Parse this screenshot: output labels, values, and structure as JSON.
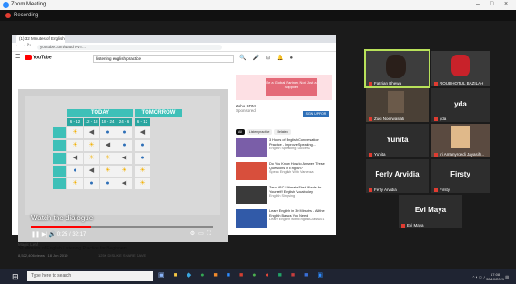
{
  "window": {
    "title": "Zoom Meeting",
    "controls": [
      "–",
      "□",
      "×"
    ]
  },
  "recording": {
    "label": "Recording"
  },
  "browser": {
    "tab_label": "(1) 32 Minutes of English ...",
    "url": "youtube.com/watch?v=..."
  },
  "youtube": {
    "logo": "YouTube",
    "search_value": "listening english practice",
    "video": {
      "board": {
        "today": "TODAY",
        "tomorrow": "TOMORROW",
        "times": [
          "6 - 12",
          "12 - 18",
          "18 - 24",
          "24 - 6",
          "6 - 12"
        ]
      },
      "caption": "Watch the dialogue",
      "progress": 0.33,
      "time_readout": "0:25 / 32:17",
      "channel": "Magic Leaf",
      "title": "32 Minutes of English Listening Practice for Beginners",
      "stats": "8,522,406 views · 18 Jun 2019",
      "actions": "125K   DISLIKE   SHARE   SAVE"
    },
    "ad": {
      "text": "Be a Global Partner, Not Just a Supplier"
    },
    "sponsor": {
      "name": "Zoho CRM",
      "label": "Sponsored",
      "signup": "SIGN UP FOR"
    },
    "chips": [
      "All",
      "Listen practice",
      "Related"
    ],
    "recs": [
      {
        "title": "3 Hours of English Conversation Practice - Improve Speaking...",
        "channel": "English Speaking Success",
        "thumb": "#7a5ea8"
      },
      {
        "title": "Do You Know How to Answer These Questions in English?",
        "channel": "Speak English With Vanessa",
        "thumb": "#d84f3c"
      },
      {
        "title": "Zero ABC Ultimate First Words for Yourself! English Vocabulary",
        "channel": "English Singsing",
        "thumb": "#3a3a3a"
      },
      {
        "title": "Learn English in 30 Minutes - All the English Basics You Need",
        "channel": "Learn English with EnglishClass101",
        "thumb": "#315aa8"
      }
    ]
  },
  "participants": [
    {
      "name": "Fazrian Bhewa",
      "kind": "video",
      "active": true
    },
    {
      "name": "ROUDHOTUL BAZILAH",
      "kind": "video",
      "active": false
    },
    {
      "name": "Zuki Noerwasiati",
      "kind": "video",
      "active": false
    },
    {
      "name": "yda",
      "kind": "name",
      "active": false
    },
    {
      "name": "Yunita",
      "kind": "name",
      "active": false
    },
    {
      "name": "Iri Amanyroedi Jayasih...",
      "kind": "video",
      "active": false
    },
    {
      "name": "Ferly Arvidia",
      "kind": "name",
      "active": false
    },
    {
      "name": "Firsty",
      "kind": "name",
      "active": false
    },
    {
      "name": "Evi Maya",
      "kind": "name",
      "active": false
    }
  ],
  "taskbar": {
    "search_placeholder": "Type here to search",
    "time": "17:08",
    "date": "30/10/2021"
  }
}
